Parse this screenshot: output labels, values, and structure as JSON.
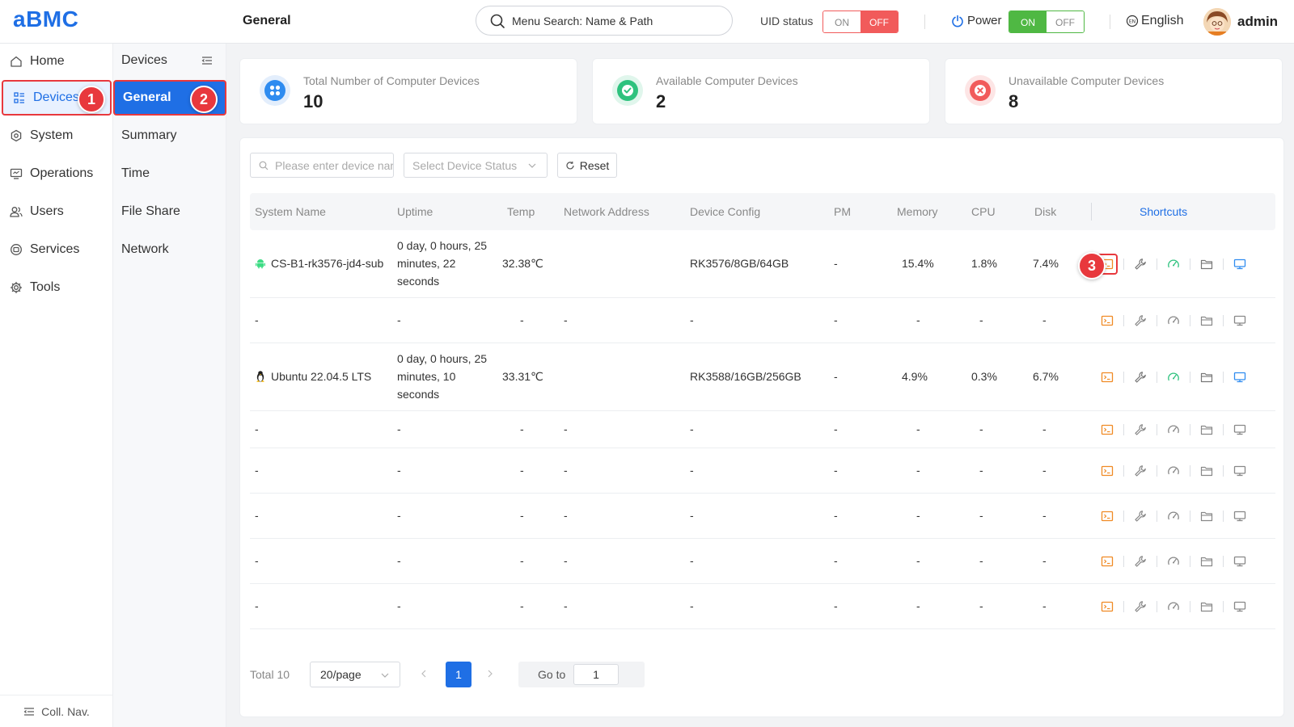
{
  "app": {
    "logo": "aBMC",
    "page_title": "General"
  },
  "header": {
    "search_placeholder": "Menu Search: Name & Path",
    "uid_label": "UID status",
    "uid_on": "ON",
    "uid_off": "OFF",
    "power_label": "Power",
    "power_on": "ON",
    "power_off": "OFF",
    "language": "English",
    "username": "admin"
  },
  "leftnav": {
    "items": [
      {
        "label": "Home",
        "icon": "home-icon"
      },
      {
        "label": "Devices",
        "icon": "grid-list-icon",
        "active": true
      },
      {
        "label": "System",
        "icon": "gear-hex-icon"
      },
      {
        "label": "Operations",
        "icon": "monitor-icon"
      },
      {
        "label": "Users",
        "icon": "users-icon"
      },
      {
        "label": "Services",
        "icon": "services-icon"
      },
      {
        "label": "Tools",
        "icon": "cog-icon"
      }
    ],
    "collapse_label": "Coll. Nav."
  },
  "subnav": {
    "title": "Devices",
    "items": [
      {
        "label": "General",
        "active": true
      },
      {
        "label": "Summary"
      },
      {
        "label": "Time"
      },
      {
        "label": "File Share"
      },
      {
        "label": "Network"
      }
    ]
  },
  "badges": [
    "1",
    "2",
    "3"
  ],
  "cards": [
    {
      "label": "Total Number of Computer Devices",
      "value": "10",
      "color": "#2f8cf0"
    },
    {
      "label": "Available Computer Devices",
      "value": "2",
      "color": "#2ec27e"
    },
    {
      "label": "Unavailable Computer Devices",
      "value": "8",
      "color": "#f15b5b"
    }
  ],
  "filters": {
    "device_placeholder": "Please enter device name",
    "status_placeholder": "Select Device Status",
    "reset_label": "Reset"
  },
  "table": {
    "columns": [
      "System Name",
      "Uptime",
      "Temp",
      "Network Address",
      "Device Config",
      "PM",
      "Memory",
      "CPU",
      "Disk",
      "Shortcuts"
    ],
    "rows": [
      {
        "os": "android",
        "name": "CS-B1-rk3576-jd4-sub",
        "uptime": "0 day, 0 hours, 25 minutes, 22 seconds",
        "temp": "32.38℃",
        "network": "",
        "config": "RK3576/8GB/64GB",
        "pm": "-",
        "memory": "15.4%",
        "cpu": "1.8%",
        "disk": "7.4%",
        "online": true
      },
      {
        "os": "",
        "name": "-",
        "uptime": "-",
        "temp": "-",
        "network": "-",
        "config": "-",
        "pm": "-",
        "memory": "-",
        "cpu": "-",
        "disk": "-",
        "online": false
      },
      {
        "os": "linux",
        "name": "Ubuntu 22.04.5 LTS",
        "uptime": "0 day, 0 hours, 25 minutes, 10 seconds",
        "temp": "33.31℃",
        "network": "",
        "config": "RK3588/16GB/256GB",
        "pm": "-",
        "memory": "4.9%",
        "cpu": "0.3%",
        "disk": "6.7%",
        "online": true
      },
      {
        "os": "",
        "name": "-",
        "uptime": "-",
        "temp": "-",
        "network": "-",
        "config": "-",
        "pm": "-",
        "memory": "-",
        "cpu": "-",
        "disk": "-",
        "online": false
      },
      {
        "os": "",
        "name": "-",
        "uptime": "-",
        "temp": "-",
        "network": "-",
        "config": "-",
        "pm": "-",
        "memory": "-",
        "cpu": "-",
        "disk": "-",
        "online": false
      },
      {
        "os": "",
        "name": "-",
        "uptime": "-",
        "temp": "-",
        "network": "-",
        "config": "-",
        "pm": "-",
        "memory": "-",
        "cpu": "-",
        "disk": "-",
        "online": false
      },
      {
        "os": "",
        "name": "-",
        "uptime": "-",
        "temp": "-",
        "network": "-",
        "config": "-",
        "pm": "-",
        "memory": "-",
        "cpu": "-",
        "disk": "-",
        "online": false
      },
      {
        "os": "",
        "name": "-",
        "uptime": "-",
        "temp": "-",
        "network": "-",
        "config": "-",
        "pm": "-",
        "memory": "-",
        "cpu": "-",
        "disk": "-",
        "online": false
      }
    ],
    "shortcut_icons": [
      "terminal-icon",
      "wrench-icon",
      "gauge-icon",
      "folder-icon",
      "desktop-icon"
    ]
  },
  "pagination": {
    "total": "Total 10",
    "page_size": "20/page",
    "current_page": "1",
    "goto_label": "Go to",
    "goto_value": "1"
  },
  "colors": {
    "primary": "#1f6fe5",
    "danger": "#e8383d",
    "terminal": "#f08a24",
    "success": "#2ec27e",
    "online_blue": "#2f8cf0"
  }
}
